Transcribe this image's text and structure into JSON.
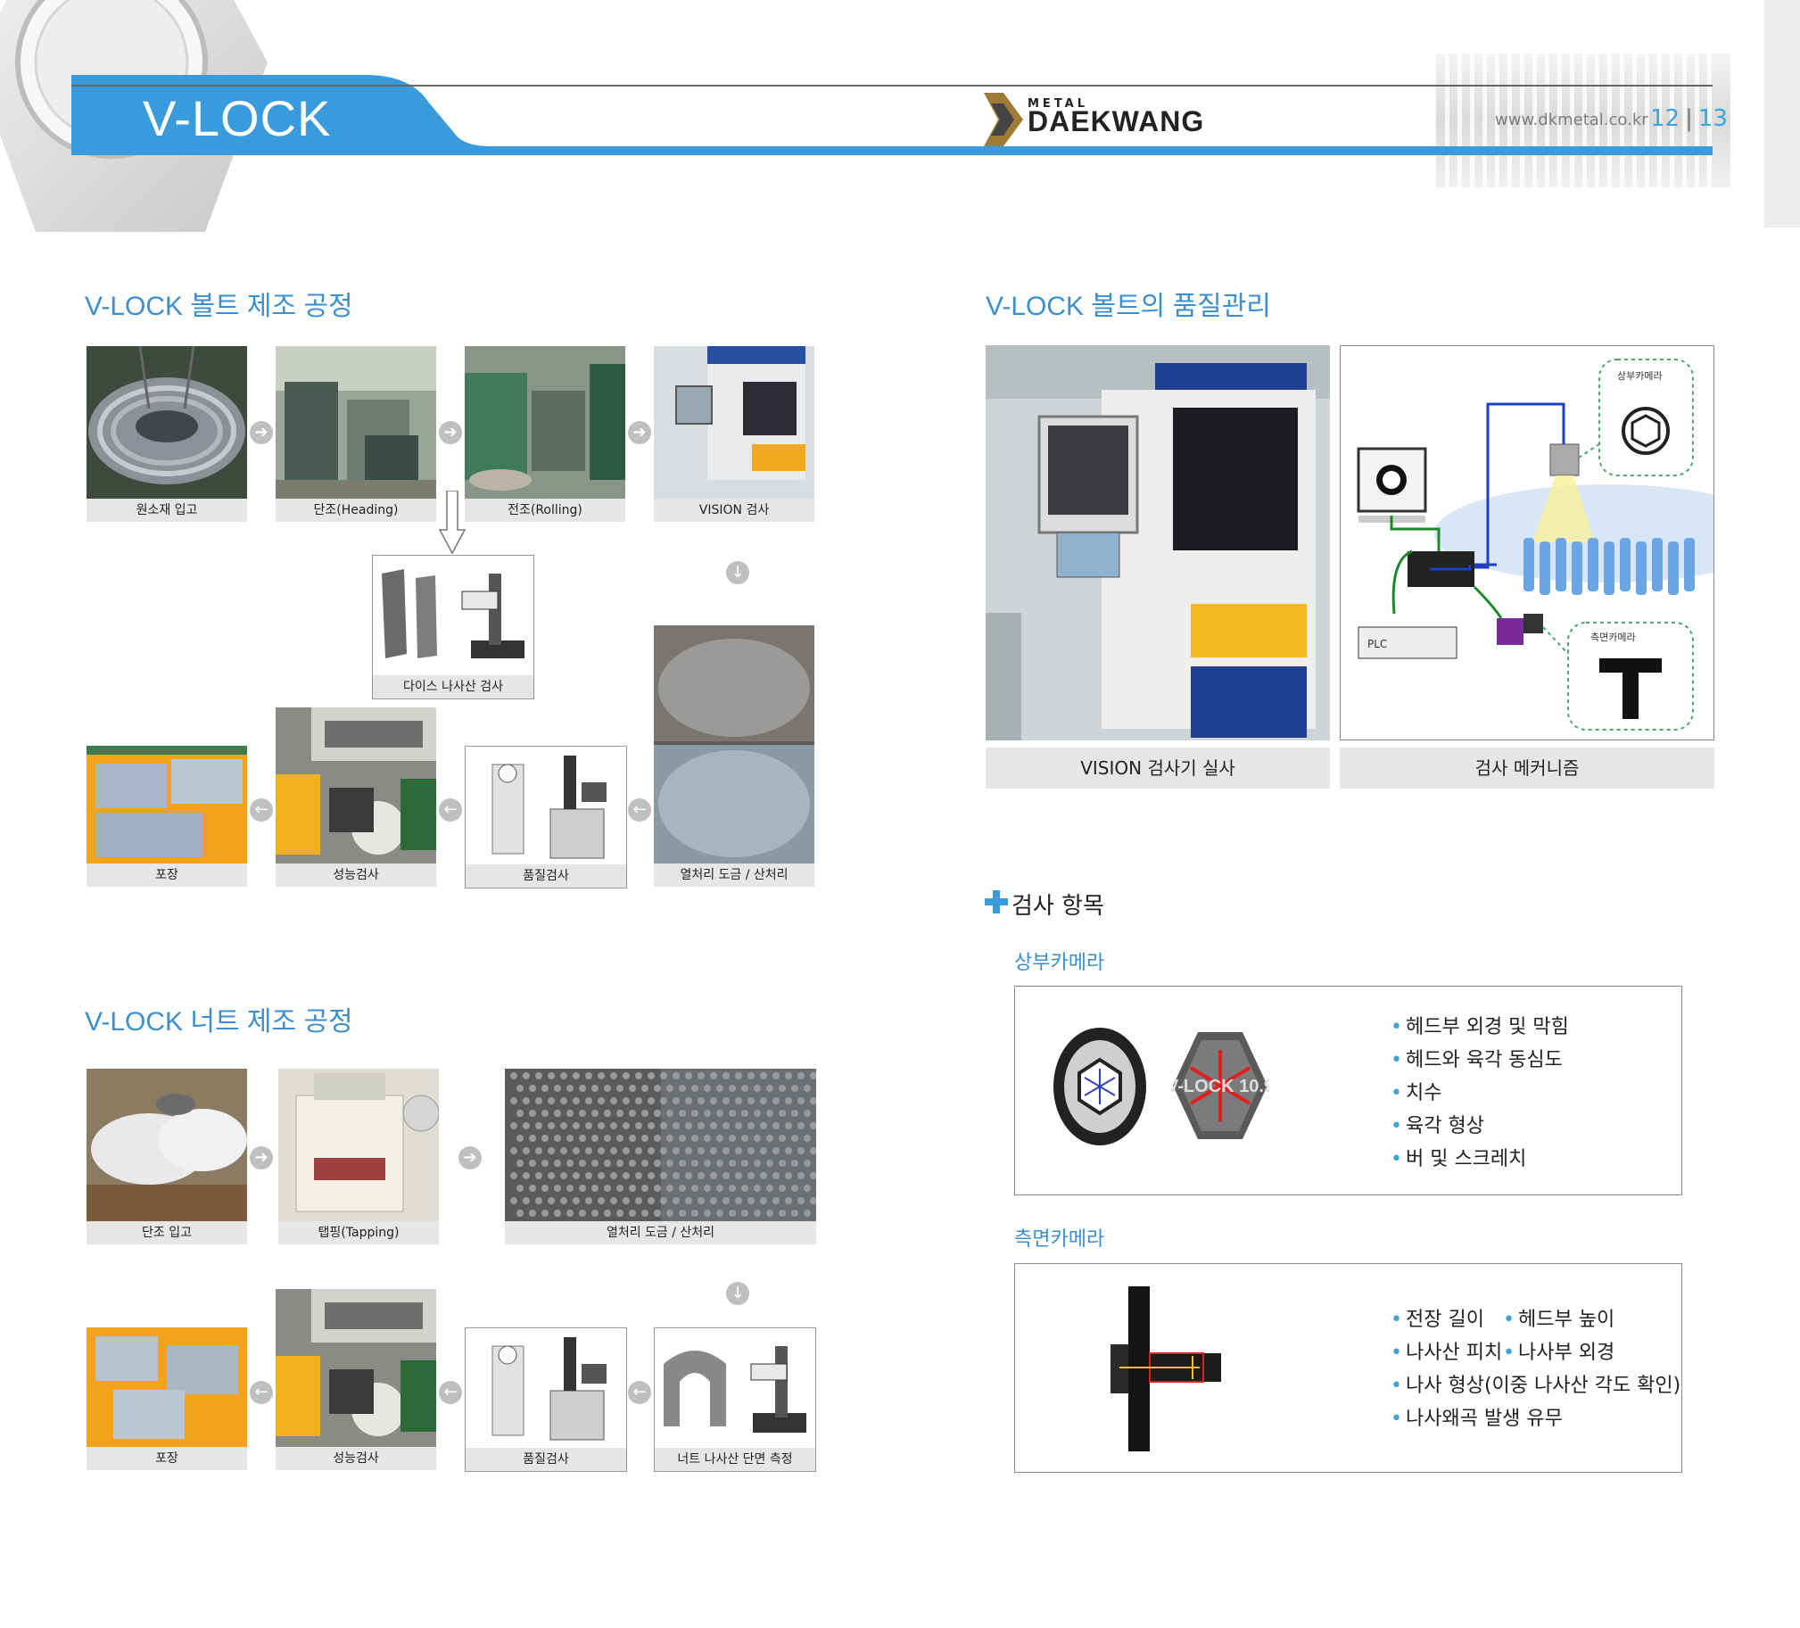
{
  "header": {
    "title": "V-LOCK",
    "brand_small": "METAL",
    "brand_name": "DAEKWANG",
    "url": "www.dkmetal.co.kr",
    "page_left": "12",
    "page_right": "13",
    "accent_color": "#3a9bdc"
  },
  "bolt_process": {
    "title": "V-LOCK 볼트 제조 공정",
    "steps": [
      "원소재 입고",
      "단조(Heading)",
      "전조(Rolling)",
      "VISION 검사",
      "다이스 나사산 검사",
      "포장",
      "성능검사",
      "품질검사",
      "열처리 도금 / 산처리"
    ]
  },
  "nut_process": {
    "title": "V-LOCK 너트 제조 공정",
    "steps": [
      "단조 입고",
      "탭핑(Tapping)",
      "열처리 도금 / 산처리",
      "포장",
      "성능검사",
      "품질검사",
      "너트 나사산 단면 측정"
    ]
  },
  "quality": {
    "title": "V-LOCK 볼트의 품질관리",
    "photo_caption": "VISION 검사기 실사",
    "diagram_caption": "검사 메커니즘",
    "diagram_labels": {
      "top_camera": "상부카메라",
      "side_camera": "측면카메라",
      "plc": "PLC"
    }
  },
  "inspection": {
    "heading": "검사 항목",
    "top_camera": {
      "label": "상부카메라",
      "bolt_marking": "V-LOCK 10.9",
      "items": [
        "헤드부 외경 및 막힘",
        "헤드와 육각 동심도",
        "치수",
        "육각 형상",
        "버 및 스크레치"
      ]
    },
    "side_camera": {
      "label": "측면카메라",
      "items": [
        "전장 길이",
        "헤드부 높이",
        "나사산 피치",
        "나사부 외경",
        "나사 형상(이중 나사산 각도 확인)",
        "나사왜곡 발생 유무"
      ]
    }
  }
}
